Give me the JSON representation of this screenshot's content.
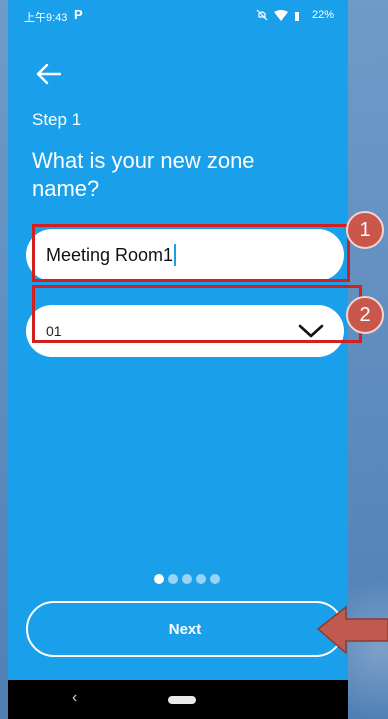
{
  "status_bar": {
    "time": "上午9:43",
    "app_icon": "P",
    "battery": "22%"
  },
  "header": {
    "step": "Step 1",
    "title": "What is your new zone name?"
  },
  "zone_name_input": {
    "value": "Meeting Room1"
  },
  "zone_select": {
    "selected": "01"
  },
  "annotations": {
    "badge_1": "1",
    "badge_2": "2"
  },
  "pagination": {
    "total": 5,
    "active": 1
  },
  "next_button": {
    "label": "Next"
  },
  "nav_bar": {
    "back": "‹"
  },
  "colors": {
    "screen": "#1aa0ea",
    "highlight": "#d02020",
    "badge": "#c9574b",
    "arrow": "#c15a4e"
  },
  "icons": [
    "back-arrow-icon",
    "chevron-down-icon",
    "mute-icon",
    "wifi-icon",
    "signal-icon",
    "battery-icon"
  ]
}
